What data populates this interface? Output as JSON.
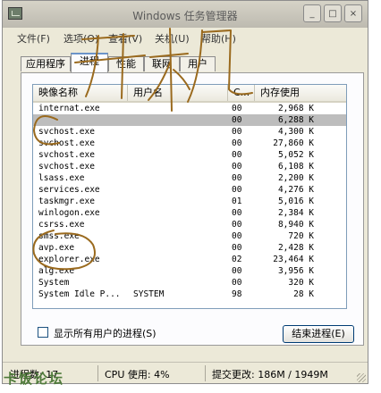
{
  "window": {
    "title": "Windows 任务管理器",
    "controls": {
      "minimize": "_",
      "maximize": "□",
      "close": "×"
    }
  },
  "menu": [
    "文件(F)",
    "选项(O)",
    "查看(V)",
    "关机(U)",
    "帮助(H)"
  ],
  "tabs": [
    "应用程序",
    "进程",
    "性能",
    "联网",
    "用户"
  ],
  "active_tab": "进程",
  "columns": {
    "name": "映像名称",
    "user": "用户名",
    "cpu": "C...",
    "mem": "内存使用"
  },
  "processes": [
    {
      "name": "internat.exe",
      "user": "",
      "cpu": "00",
      "mem": "2,968 K"
    },
    {
      "name": "",
      "user": "",
      "cpu": "00",
      "mem": "6,288 K",
      "selected": true
    },
    {
      "name": "svchost.exe",
      "user": "",
      "cpu": "00",
      "mem": "4,300 K"
    },
    {
      "name": "svchost.exe",
      "user": "",
      "cpu": "00",
      "mem": "27,860 K"
    },
    {
      "name": "svchost.exe",
      "user": "",
      "cpu": "00",
      "mem": "5,052 K"
    },
    {
      "name": "svchost.exe",
      "user": "",
      "cpu": "00",
      "mem": "6,108 K"
    },
    {
      "name": "lsass.exe",
      "user": "",
      "cpu": "00",
      "mem": "2,200 K"
    },
    {
      "name": "services.exe",
      "user": "",
      "cpu": "00",
      "mem": "4,276 K"
    },
    {
      "name": "taskmgr.exe",
      "user": "",
      "cpu": "01",
      "mem": "5,016 K"
    },
    {
      "name": "winlogon.exe",
      "user": "",
      "cpu": "00",
      "mem": "2,384 K"
    },
    {
      "name": "csrss.exe",
      "user": "",
      "cpu": "00",
      "mem": "8,940 K"
    },
    {
      "name": "smss.exe",
      "user": "",
      "cpu": "00",
      "mem": "720 K"
    },
    {
      "name": "avp.exe",
      "user": "",
      "cpu": "00",
      "mem": "2,428 K"
    },
    {
      "name": "explorer.exe",
      "user": "",
      "cpu": "02",
      "mem": "23,464 K"
    },
    {
      "name": "alg.exe",
      "user": "",
      "cpu": "00",
      "mem": "3,956 K"
    },
    {
      "name": "System",
      "user": "",
      "cpu": "00",
      "mem": "320 K"
    },
    {
      "name": "System Idle P...",
      "user": "SYSTEM",
      "cpu": "98",
      "mem": "28 K"
    }
  ],
  "show_all_users_label": "显示所有用户的进程(S)",
  "end_process_label": "结束进程(E)",
  "status": {
    "processes": "进程数: 17",
    "cpu": "CPU 使用: 4%",
    "commit": "提交更改: 186M / 1949M"
  },
  "annotation": {
    "handwritten_text": "开机",
    "ink_color": "#9a6a1e"
  },
  "watermark": "卡饭论坛",
  "colors": {
    "tab_accent": "#6b94c9",
    "list_border": "#7f9db9",
    "selected_row": "#bdbdbd"
  }
}
